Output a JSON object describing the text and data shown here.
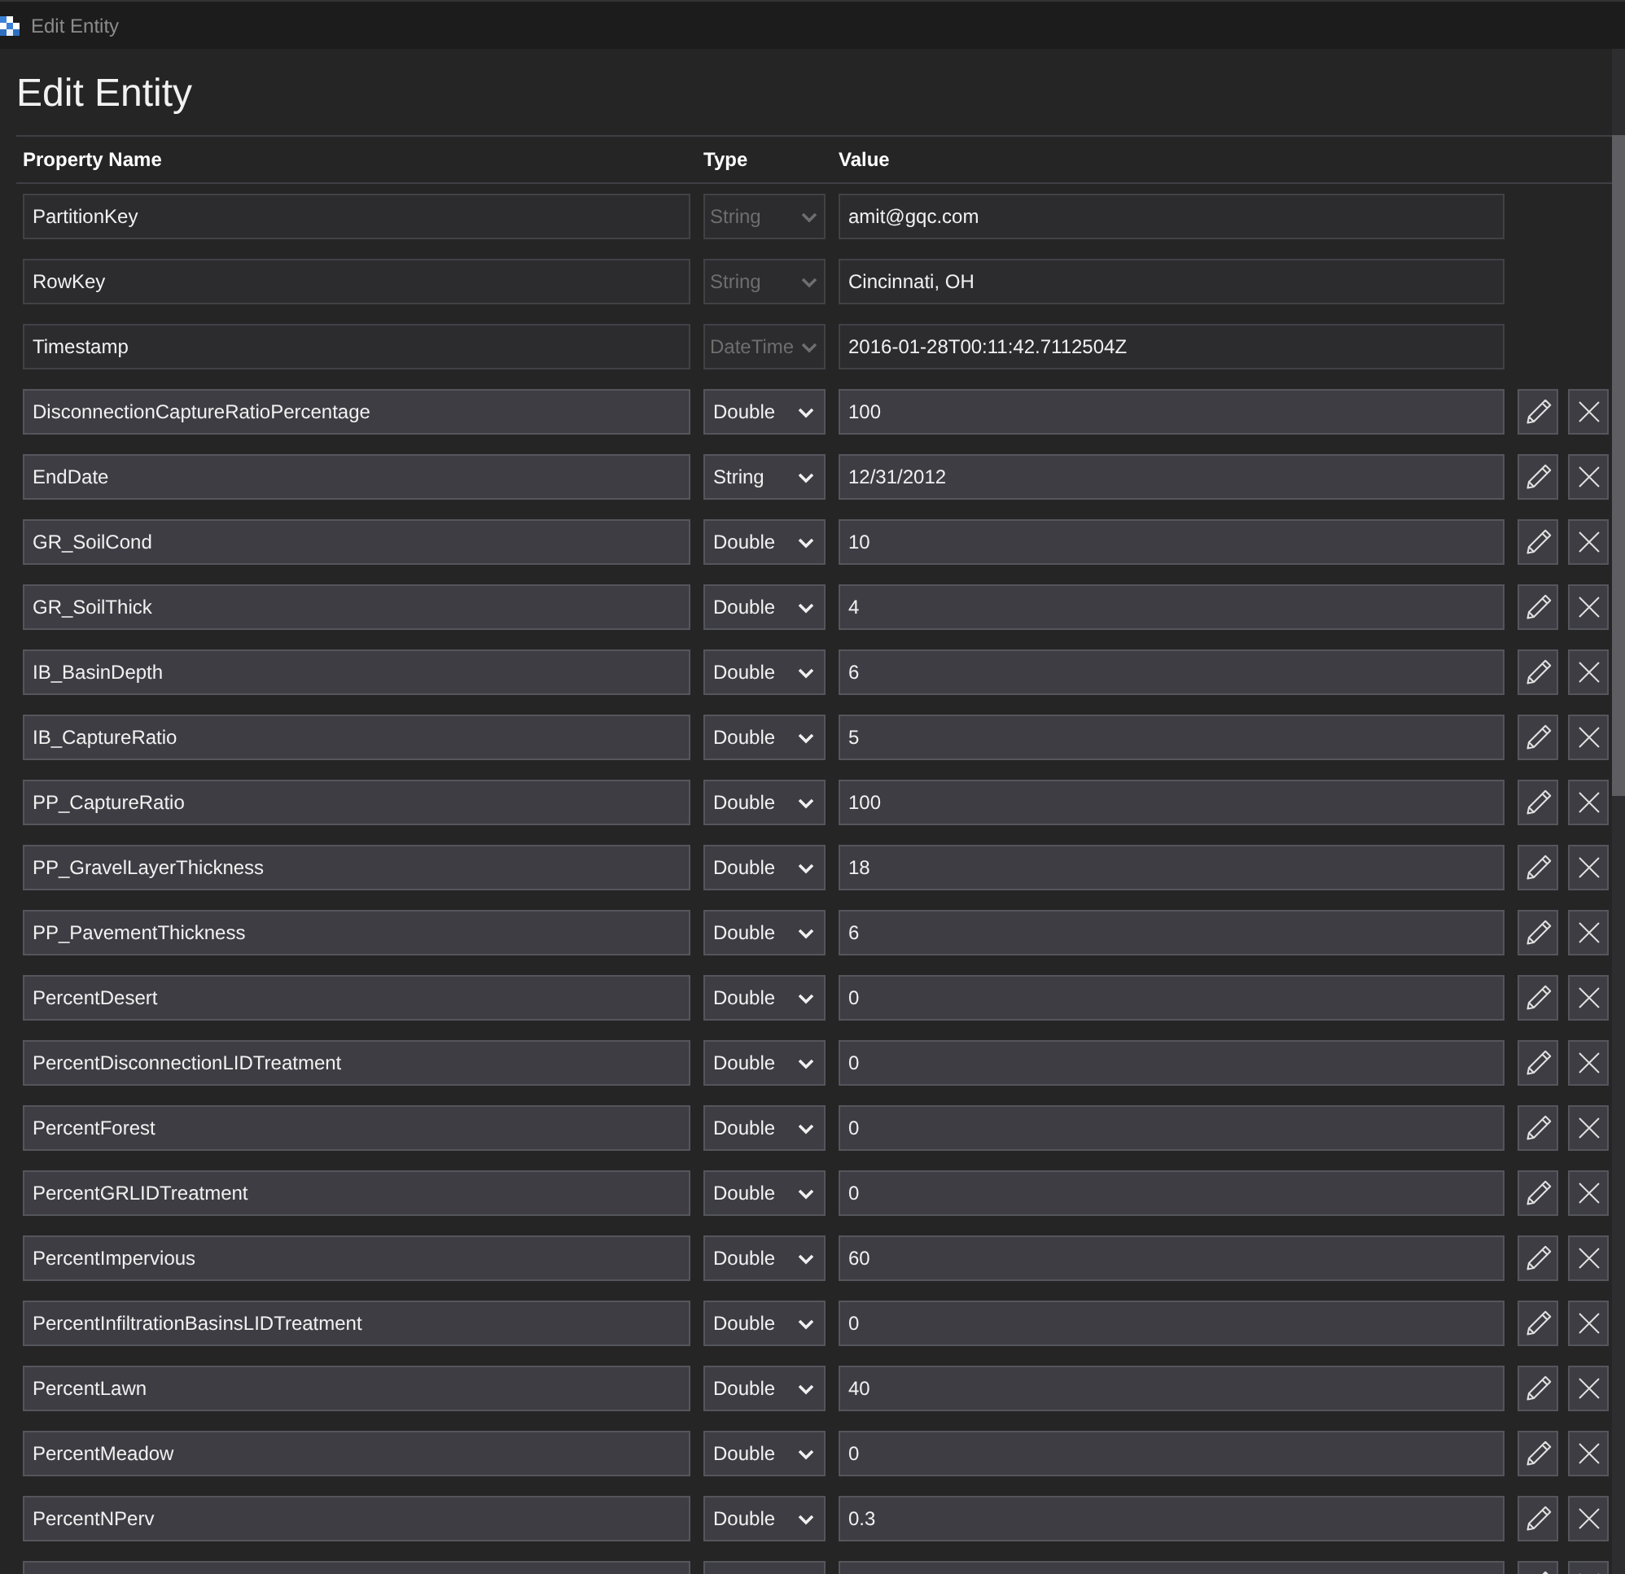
{
  "window": {
    "title": "Edit Entity"
  },
  "heading": "Edit Entity",
  "columns": [
    "Property Name",
    "Type",
    "Value"
  ],
  "rows": [
    {
      "name": "PartitionKey",
      "type": "String",
      "value": "amit@gqc.com",
      "disabled": true
    },
    {
      "name": "RowKey",
      "type": "String",
      "value": "Cincinnati, OH",
      "disabled": true
    },
    {
      "name": "Timestamp",
      "type": "DateTime",
      "value": "2016-01-28T00:11:42.7112504Z",
      "disabled": true
    },
    {
      "name": "DisconnectionCaptureRatioPercentage",
      "type": "Double",
      "value": "100",
      "disabled": false
    },
    {
      "name": "EndDate",
      "type": "String",
      "value": "12/31/2012",
      "disabled": false
    },
    {
      "name": "GR_SoilCond",
      "type": "Double",
      "value": "10",
      "disabled": false
    },
    {
      "name": "GR_SoilThick",
      "type": "Double",
      "value": "4",
      "disabled": false
    },
    {
      "name": "IB_BasinDepth",
      "type": "Double",
      "value": "6",
      "disabled": false
    },
    {
      "name": "IB_CaptureRatio",
      "type": "Double",
      "value": "5",
      "disabled": false
    },
    {
      "name": "PP_CaptureRatio",
      "type": "Double",
      "value": "100",
      "disabled": false
    },
    {
      "name": "PP_GravelLayerThickness",
      "type": "Double",
      "value": "18",
      "disabled": false
    },
    {
      "name": "PP_PavementThickness",
      "type": "Double",
      "value": "6",
      "disabled": false
    },
    {
      "name": "PercentDesert",
      "type": "Double",
      "value": "0",
      "disabled": false
    },
    {
      "name": "PercentDisconnectionLIDTreatment",
      "type": "Double",
      "value": "0",
      "disabled": false
    },
    {
      "name": "PercentForest",
      "type": "Double",
      "value": "0",
      "disabled": false
    },
    {
      "name": "PercentGRLIDTreatment",
      "type": "Double",
      "value": "0",
      "disabled": false
    },
    {
      "name": "PercentImpervious",
      "type": "Double",
      "value": "60",
      "disabled": false
    },
    {
      "name": "PercentInfiltrationBasinsLIDTreatment",
      "type": "Double",
      "value": "0",
      "disabled": false
    },
    {
      "name": "PercentLawn",
      "type": "Double",
      "value": "40",
      "disabled": false
    },
    {
      "name": "PercentMeadow",
      "type": "Double",
      "value": "0",
      "disabled": false
    },
    {
      "name": "PercentNPerv",
      "type": "Double",
      "value": "0.3",
      "disabled": false
    }
  ],
  "more_rows_below": true
}
